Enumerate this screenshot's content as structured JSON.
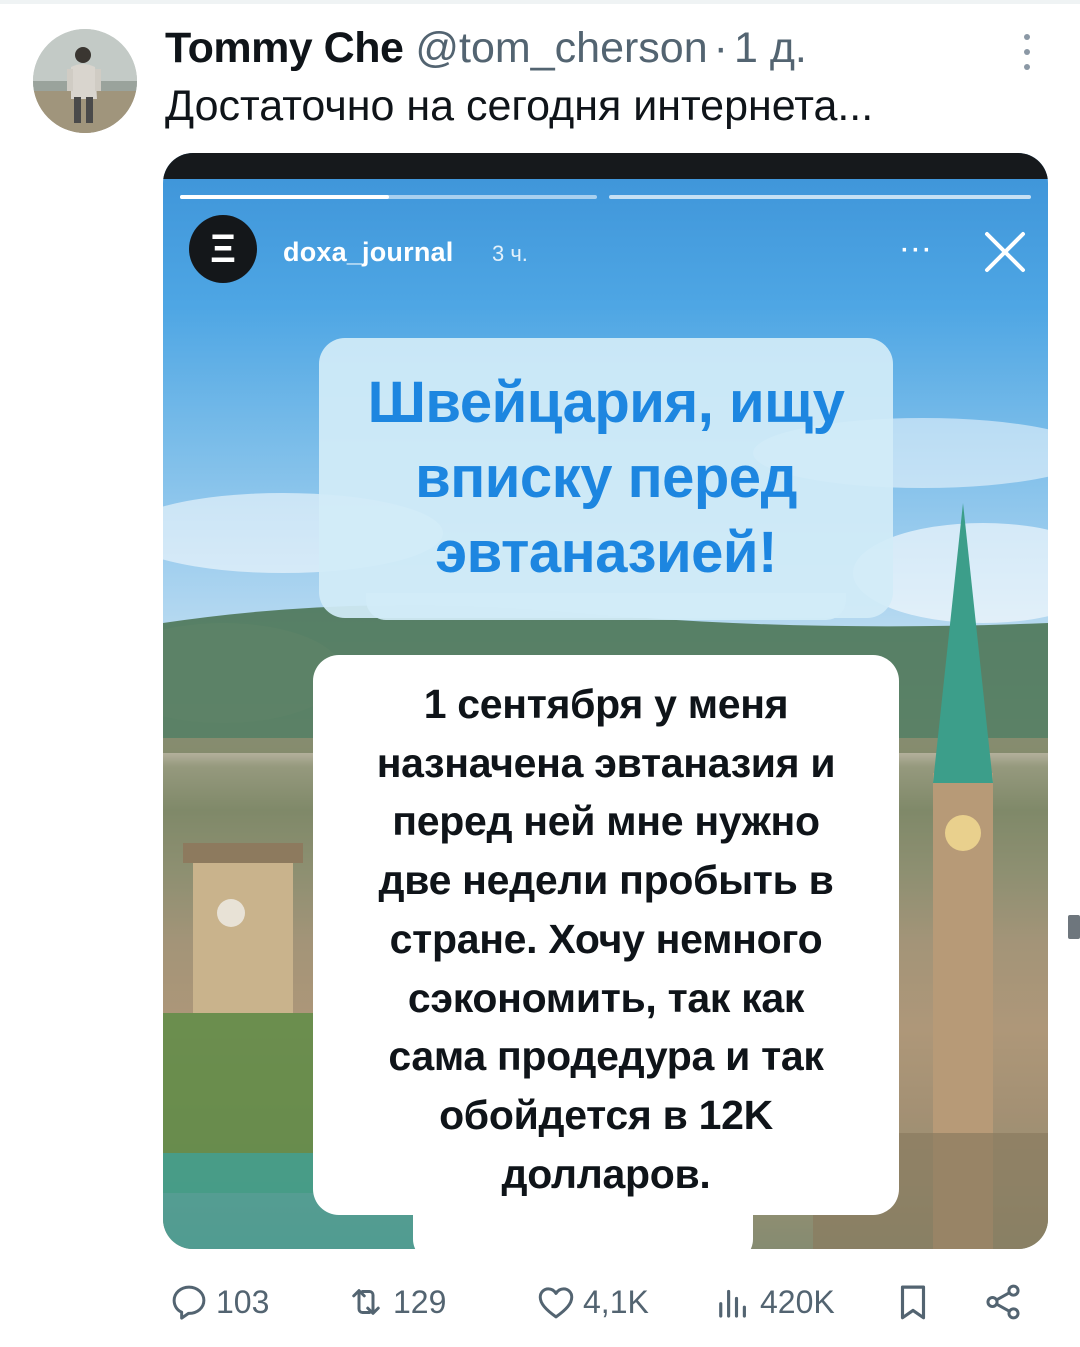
{
  "tweet": {
    "author_name": "Tommy Che",
    "handle": "@tom_cherson",
    "separator": "·",
    "time": "1 д.",
    "text": "Достаточно на сегодня интернета..."
  },
  "story": {
    "avatar_letter": "Ξ",
    "username": "doxa_journal",
    "time": "3 ч.",
    "more": "···",
    "progress_first_segment": 0.5,
    "headline_lines": [
      "Швейцария, ищу",
      "вписку перед",
      "эвтаназией!"
    ],
    "body_lines": [
      "1 сентября у меня",
      "назначена эвтаназия и",
      "перед ней мне нужно",
      "две недели пробыть в",
      "стране. Хочу немного",
      "сэкономить, так как",
      "сама продедура и так",
      "обойдется в 12K",
      "долларов."
    ],
    "headline_color": "#1d86e0"
  },
  "actions": {
    "replies": "103",
    "reposts": "129",
    "likes": "4,1K",
    "views": "420K"
  },
  "colors": {
    "text": "#0f1419",
    "secondary": "#536471"
  }
}
